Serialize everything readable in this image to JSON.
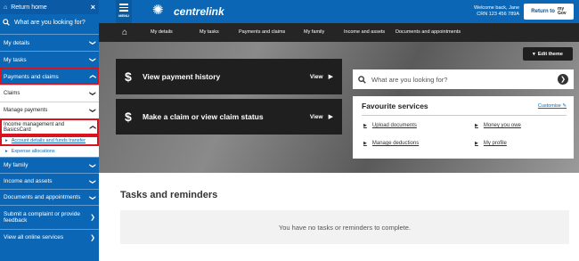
{
  "sidebar": {
    "return_label": "Return home",
    "close_glyph": "×",
    "search_placeholder": "What are you looking for?",
    "chevron": "❯",
    "items": {
      "my_details": "My details",
      "my_tasks": "My tasks",
      "payments": "Payments and claims",
      "claims": "Claims",
      "manage_payments": "Manage payments",
      "income_mgmt": "Income management and BasicsCard",
      "account_details": "Account details and funds transfer",
      "expense_allocations": "Expense allocations",
      "my_family": "My family",
      "income_assets": "Income and assets",
      "documents": "Documents and appointments",
      "complaint": "Submit a complaint or provide feedback",
      "view_all": "View all online services"
    },
    "highlight_color": "#d9141e"
  },
  "header": {
    "menu_label": "MENU",
    "brand": "centrelink",
    "welcome_line1": "Welcome back, Jane",
    "welcome_line2": "CRN 123 456 789A",
    "return_label": "Return to",
    "mygov_line1": "my",
    "mygov_line2": "Gov"
  },
  "nav": {
    "items": [
      "My details",
      "My tasks",
      "Payments and claims",
      "My family",
      "Income and assets",
      "Documents and appointments"
    ]
  },
  "hero": {
    "edit_theme": "Edit theme",
    "tiles": [
      {
        "label": "View payment history",
        "view": "View"
      },
      {
        "label": "Make a claim or view claim status",
        "view": "View"
      }
    ],
    "search_placeholder": "What are you looking for?",
    "favourites": {
      "title": "Favourite services",
      "customise": "Customise",
      "links": [
        "Upload documents",
        "Money you owe",
        "Manage deductions",
        "My profile"
      ]
    }
  },
  "tasks": {
    "title": "Tasks and reminders",
    "empty": "You have no tasks or reminders to complete."
  },
  "colors": {
    "brand_blue": "#0b67b5",
    "nav_dark": "#252525",
    "highlight_red": "#d9141e"
  }
}
